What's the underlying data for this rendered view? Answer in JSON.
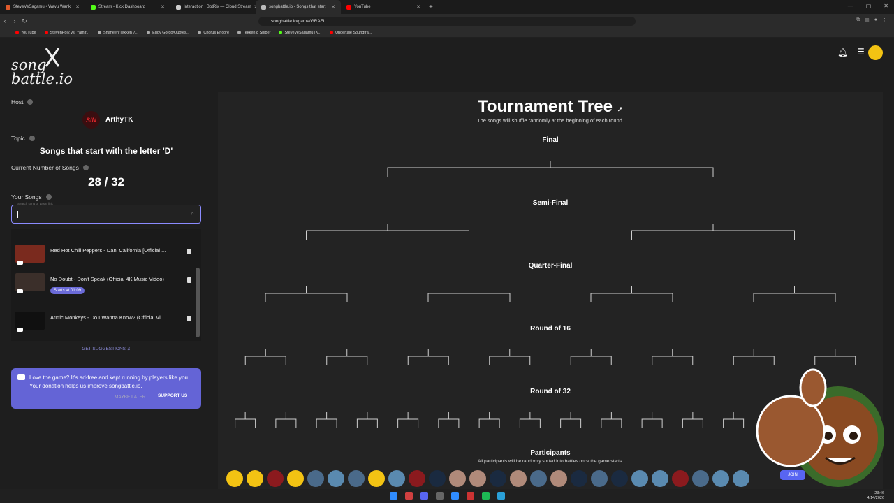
{
  "browser": {
    "tabs": [
      {
        "label": "SteveVeSagamu • Wavu Wank",
        "color": "#e05a2b"
      },
      {
        "label": "Stream - Kick Dashboard",
        "color": "#53fc18"
      },
      {
        "label": "Interaction | BotRix — Cloud Stream",
        "color": "#cccccc"
      },
      {
        "label": "songbattle.io - Songs that start",
        "color": "#bbbbbb"
      },
      {
        "label": "YouTube",
        "color": "#ff0000"
      }
    ],
    "url": "songbattle.io/game/GRAFL",
    "bookmarks": [
      {
        "label": "YouTube",
        "color": "#ff0000"
      },
      {
        "label": "StevenPol2 vs. Yamir...",
        "color": "#ff0000"
      },
      {
        "label": "Shaheen/Tekken 7...",
        "color": "#aaaaaa"
      },
      {
        "label": "Eddy Gordo/Quotes...",
        "color": "#aaaaaa"
      },
      {
        "label": "Chorus Encore",
        "color": "#aaaaaa"
      },
      {
        "label": "Tekken 8 Sniper",
        "color": "#aaaaaa"
      },
      {
        "label": "SteveVeSagamuTK...",
        "color": "#53fc18"
      },
      {
        "label": "Undertale Soundtra...",
        "color": "#ff0000"
      }
    ]
  },
  "logo": {
    "line1": "song",
    "line2": "battle.io"
  },
  "sidebar": {
    "host_label": "Host",
    "host_name": "ArthyTK",
    "host_badge": "SIN",
    "topic_label": "Topic",
    "topic": "Songs that start with the letter 'D'",
    "count_label": "Current Number of Songs",
    "count": "28 / 32",
    "your_songs_label": "Your Songs",
    "search_placeholder": "Search song or paste link",
    "songs": [
      {
        "title": "Red Hot Chili Peppers - Dani California [Official ...",
        "thumb": "#7a2a1e"
      },
      {
        "title": "No Doubt - Don't Speak (Official 4K Music Video)",
        "thumb": "#3b2f2a",
        "starts": "Starts at 01:09"
      },
      {
        "title": "Arctic Monkeys - Do I Wanna Know? (Official Vi...",
        "thumb": "#101010"
      }
    ],
    "suggestions": "GET SUGGESTIONS",
    "donate_text": "Love the game? It's ad-free and kept running by players like you. Your donation helps us improve songbattle.io.",
    "maybe_later": "MAYBE LATER",
    "support": "SUPPORT US"
  },
  "tree": {
    "title": "Tournament Tree",
    "subtitle": "The songs will shuffle randomly at the beginning of each round.",
    "rounds": [
      "Final",
      "Semi-Final",
      "Quarter-Final",
      "Round of 16",
      "Round of 32"
    ],
    "participants_label": "Participants",
    "participants_sub": "All participants will be randomly sorted into battles once the game starts.",
    "participant_colors": [
      "#f3c313",
      "#f3c313",
      "#8b1a1e",
      "#f3c313",
      "#4a6a8a",
      "#5a8ab0",
      "#4a6a8a",
      "#f3c313",
      "#5a8ab0",
      "#8b1a1e",
      "#1a2a40",
      "#b08a7a",
      "#b08a7a",
      "#1a2a40",
      "#b08a7a",
      "#4a6a8a",
      "#b08a7a",
      "#1a2a40",
      "#4a6a8a",
      "#1a2a40",
      "#5a8ab0",
      "#5a8ab0",
      "#8b1a1e",
      "#4a6a8a",
      "#5a8ab0",
      "#5a8ab0"
    ],
    "join": "JOIN"
  },
  "taskbar": {
    "time": "23:46",
    "date": "4/14/2026"
  }
}
